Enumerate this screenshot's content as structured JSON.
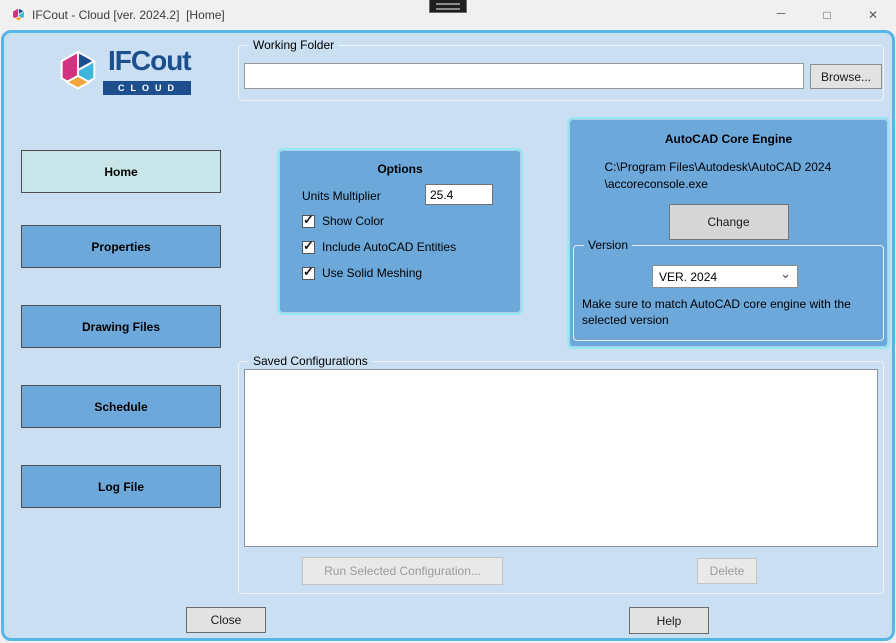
{
  "title_bar": {
    "title": "IFCout - Cloud [ver. 2024.2]  [Home]"
  },
  "icons": {
    "minimize": "─",
    "maximize": "□",
    "close": "✕",
    "checkmark": "✓",
    "chevron_down": "⌄"
  },
  "logo": {
    "name": "IFCout",
    "sub": "CLOUD"
  },
  "working_folder": {
    "label": "Working Folder",
    "input_value": "",
    "browse_label": "Browse..."
  },
  "sidebar": {
    "items": [
      {
        "label": "Home",
        "active": true
      },
      {
        "label": "Properties",
        "active": false
      },
      {
        "label": "Drawing Files",
        "active": false
      },
      {
        "label": "Schedule",
        "active": false
      },
      {
        "label": "Log File",
        "active": false
      }
    ]
  },
  "options": {
    "title": "Options",
    "units_multiplier_label": "Units Multiplier",
    "units_multiplier_value": "25.4",
    "checkboxes": [
      {
        "label": "Show Color",
        "checked": true
      },
      {
        "label": "Include AutoCAD Entities",
        "checked": true
      },
      {
        "label": "Use Solid Meshing",
        "checked": true
      }
    ]
  },
  "autocad": {
    "title": "AutoCAD Core Engine",
    "path_lines": [
      "C:\\Program Files\\Autodesk\\AutoCAD 2024",
      "\\accoreconsole.exe"
    ],
    "change_label": "Change",
    "version": {
      "label": "Version",
      "selected": "VER. 2024",
      "note": "Make sure to match AutoCAD core engine with the selected version"
    }
  },
  "saved_configurations": {
    "label": "Saved Configurations",
    "items": [],
    "run_label": "Run Selected Configuration...",
    "delete_label": "Delete"
  },
  "footer": {
    "close_label": "Close",
    "help_label": "Help"
  },
  "colors": {
    "window_border": "#56b6e8",
    "window_bg": "#cadff1",
    "panel_blue": "#6da8db",
    "panel_border": "#93e9f2",
    "active_nav_bg": "#c8e6ea",
    "nav_bg": "#6da8db",
    "logo_blue": "#1d4f8f",
    "titlebar_bg": "#f0f0f0"
  }
}
